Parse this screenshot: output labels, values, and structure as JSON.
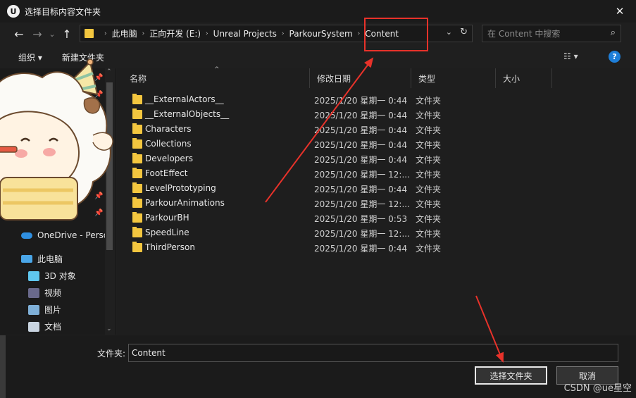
{
  "window": {
    "title": "选择目标内容文件夹",
    "app_icon": "U",
    "close_glyph": "✕"
  },
  "nav": {
    "back_glyph": "←",
    "forward_glyph": "→",
    "dropdown_glyph": "⌄",
    "up_glyph": "↑",
    "breadcrumbs": [
      "此电脑",
      "正向开发 (E:)",
      "Unreal Projects",
      "ParkourSystem",
      "Content"
    ],
    "separator": "›",
    "addr_chevron": "⌄",
    "refresh_glyph": "↻",
    "search_placeholder": "在 Content 中搜索",
    "search_glyph": "⌕"
  },
  "toolbar": {
    "organize": "组织 ▾",
    "new_folder": "新建文件夹",
    "view_glyph": "☷ ▾",
    "help_glyph": "?"
  },
  "sidebar": {
    "pin_glyph": "📌",
    "items": [
      {
        "label": "OneDrive - Perso",
        "icon": "cloud-icon"
      },
      {
        "label": "此电脑",
        "icon": "computer-icon"
      },
      {
        "label": "3D 对象",
        "icon": "cube-icon"
      },
      {
        "label": "视频",
        "icon": "video-icon"
      },
      {
        "label": "图片",
        "icon": "picture-icon"
      },
      {
        "label": "文档",
        "icon": "document-icon"
      }
    ],
    "scroll_up": "⌃",
    "scroll_down": "⌄"
  },
  "columns": {
    "name": "名称",
    "date": "修改日期",
    "type": "类型",
    "size": "大小",
    "sort_glyph": "^"
  },
  "files": [
    {
      "name": "__ExternalActors__",
      "date": "2025/1/20 星期一 0:44",
      "type": "文件夹"
    },
    {
      "name": "__ExternalObjects__",
      "date": "2025/1/20 星期一 0:44",
      "type": "文件夹"
    },
    {
      "name": "Characters",
      "date": "2025/1/20 星期一 0:44",
      "type": "文件夹"
    },
    {
      "name": "Collections",
      "date": "2025/1/20 星期一 0:44",
      "type": "文件夹"
    },
    {
      "name": "Developers",
      "date": "2025/1/20 星期一 0:44",
      "type": "文件夹"
    },
    {
      "name": "FootEffect",
      "date": "2025/1/20 星期一 12:...",
      "type": "文件夹"
    },
    {
      "name": "LevelPrototyping",
      "date": "2025/1/20 星期一 0:44",
      "type": "文件夹"
    },
    {
      "name": "ParkourAnimations",
      "date": "2025/1/20 星期一 12:...",
      "type": "文件夹"
    },
    {
      "name": "ParkourBH",
      "date": "2025/1/20 星期一 0:53",
      "type": "文件夹"
    },
    {
      "name": "SpeedLine",
      "date": "2025/1/20 星期一 12:...",
      "type": "文件夹"
    },
    {
      "name": "ThirdPerson",
      "date": "2025/1/20 星期一 0:44",
      "type": "文件夹"
    }
  ],
  "footer": {
    "folder_label": "文件夹:",
    "folder_value": "Content",
    "select_button": "选择文件夹",
    "cancel_button": "取消",
    "watermark": "CSDN @ue星空"
  },
  "colors": {
    "folder": "#f3c63f",
    "annotation_red": "#e8322a",
    "accent_blue": "#1e7ed8"
  }
}
